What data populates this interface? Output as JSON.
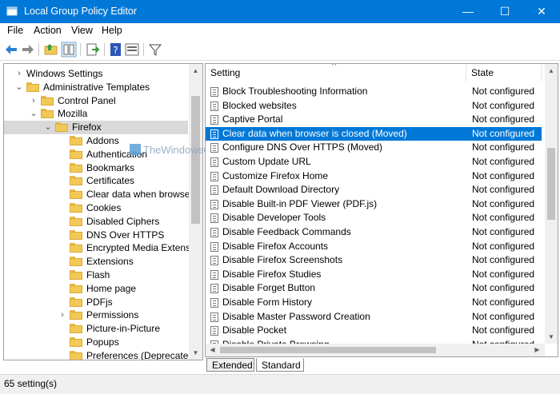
{
  "window": {
    "title": "Local Group Policy Editor",
    "minimize_glyph": "—",
    "maximize_glyph": "☐",
    "close_glyph": "✕",
    "accent": "#0078d7"
  },
  "menu": [
    "File",
    "Action",
    "View",
    "Help"
  ],
  "toolbar": {
    "buttons": [
      "back-icon",
      "forward-icon",
      "up-folder-icon",
      "show-hide-tree-icon",
      "export-list-icon",
      "help-icon",
      "properties-icon",
      "filter-icon"
    ]
  },
  "tree": {
    "items": [
      {
        "label": "Windows Settings",
        "expander": "›"
      },
      {
        "label": "Administrative Templates",
        "expander": "⌄"
      },
      {
        "label": "Control Panel",
        "expander": "›"
      },
      {
        "label": "Mozilla",
        "expander": "⌄"
      },
      {
        "label": "Firefox",
        "expander": "⌄"
      },
      {
        "label": "Addons",
        "expander": ""
      },
      {
        "label": "Authentication",
        "expander": ""
      },
      {
        "label": "Bookmarks",
        "expander": ""
      },
      {
        "label": "Certificates",
        "expander": ""
      },
      {
        "label": "Clear data when browse",
        "expander": ""
      },
      {
        "label": "Cookies",
        "expander": ""
      },
      {
        "label": "Disabled Ciphers",
        "expander": ""
      },
      {
        "label": "DNS Over HTTPS",
        "expander": ""
      },
      {
        "label": "Encrypted Media Extens",
        "expander": ""
      },
      {
        "label": "Extensions",
        "expander": ""
      },
      {
        "label": "Flash",
        "expander": ""
      },
      {
        "label": "Home page",
        "expander": ""
      },
      {
        "label": "PDFjs",
        "expander": ""
      },
      {
        "label": "Permissions",
        "expander": "›"
      },
      {
        "label": "Picture-in-Picture",
        "expander": ""
      },
      {
        "label": "Popups",
        "expander": ""
      },
      {
        "label": "Preferences (Deprecated",
        "expander": ""
      }
    ]
  },
  "list": {
    "columns": {
      "setting": "Setting",
      "state": "State"
    },
    "sort_glyph": "^",
    "rows": [
      {
        "setting": "Block Troubleshooting Information",
        "state": "Not configured"
      },
      {
        "setting": "Blocked websites",
        "state": "Not configured"
      },
      {
        "setting": "Captive Portal",
        "state": "Not configured"
      },
      {
        "setting": "Clear data when browser is closed (Moved)",
        "state": "Not configured"
      },
      {
        "setting": "Configure DNS Over HTTPS (Moved)",
        "state": "Not configured"
      },
      {
        "setting": "Custom Update URL",
        "state": "Not configured"
      },
      {
        "setting": "Customize Firefox Home",
        "state": "Not configured"
      },
      {
        "setting": "Default Download Directory",
        "state": "Not configured"
      },
      {
        "setting": "Disable Built-in PDF Viewer (PDF.js)",
        "state": "Not configured"
      },
      {
        "setting": "Disable Developer Tools",
        "state": "Not configured"
      },
      {
        "setting": "Disable Feedback Commands",
        "state": "Not configured"
      },
      {
        "setting": "Disable Firefox Accounts",
        "state": "Not configured"
      },
      {
        "setting": "Disable Firefox Screenshots",
        "state": "Not configured"
      },
      {
        "setting": "Disable Firefox Studies",
        "state": "Not configured"
      },
      {
        "setting": "Disable Forget Button",
        "state": "Not configured"
      },
      {
        "setting": "Disable Form History",
        "state": "Not configured"
      },
      {
        "setting": "Disable Master Password Creation",
        "state": "Not configured"
      },
      {
        "setting": "Disable Pocket",
        "state": "Not configured"
      },
      {
        "setting": "Disable Private Browsing",
        "state": "Not configured"
      }
    ]
  },
  "tabs": {
    "extended": "Extended",
    "standard": "Standard"
  },
  "status": {
    "text": "65 setting(s)"
  },
  "watermark": {
    "text": "TheWindowsClub"
  }
}
